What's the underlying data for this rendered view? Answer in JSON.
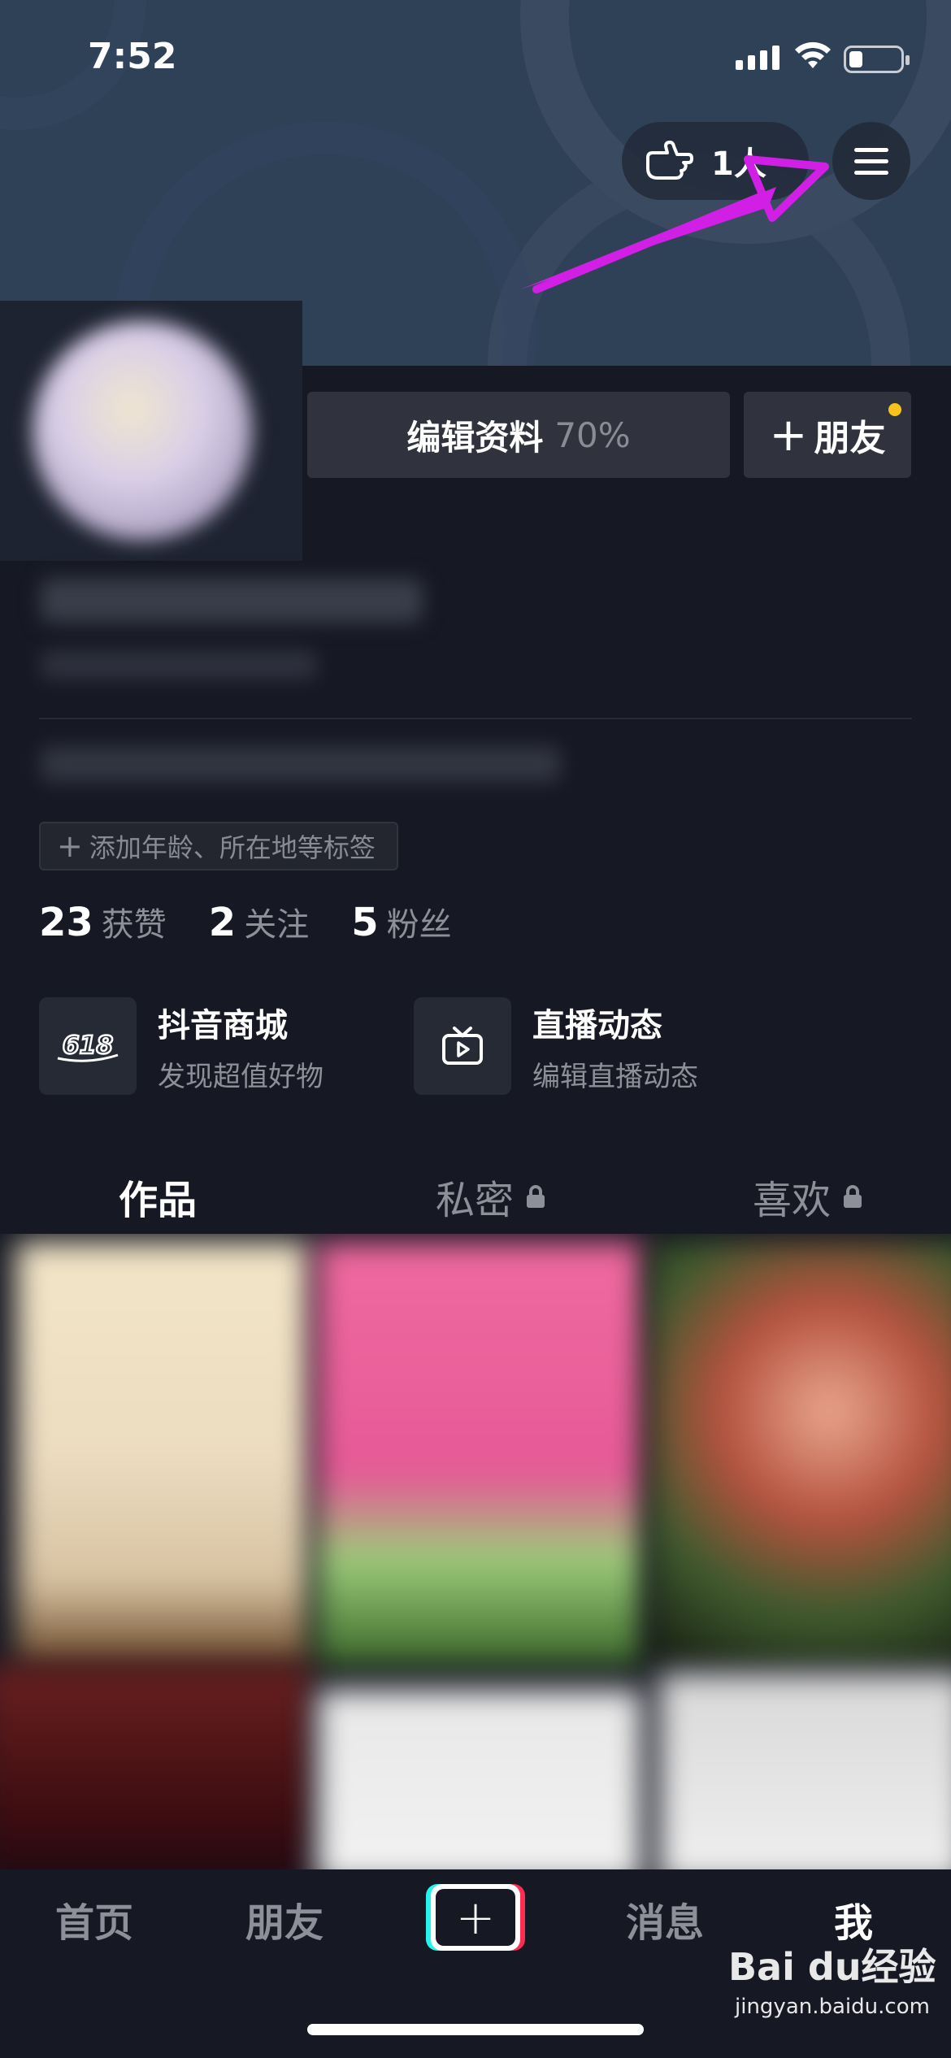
{
  "status_bar": {
    "time": "7:52"
  },
  "header": {
    "visitors_count": "1人"
  },
  "profile": {
    "edit_label": "编辑资料",
    "edit_percent": "70%",
    "add_friend_label": "朋友",
    "add_tag_label": "添加年龄、所在地等标签"
  },
  "stats": [
    {
      "num": "23",
      "label": "获赞"
    },
    {
      "num": "2",
      "label": "关注"
    },
    {
      "num": "5",
      "label": "粉丝"
    }
  ],
  "features": [
    {
      "title": "抖音商城",
      "subtitle": "发现超值好物",
      "icon": "618-icon",
      "icon_text": "618"
    },
    {
      "title": "直播动态",
      "subtitle": "编辑直播动态",
      "icon": "tv-icon"
    }
  ],
  "tabs": [
    {
      "label": "作品",
      "active": true
    },
    {
      "label": "私密",
      "locked": true
    },
    {
      "label": "喜欢",
      "locked": true
    }
  ],
  "bottom_nav": [
    {
      "label": "首页"
    },
    {
      "label": "朋友"
    },
    {
      "label": "消息"
    },
    {
      "label": "我",
      "active": true
    }
  ],
  "watermark": {
    "brand": "Bai du经验",
    "url": "jingyan.baidu.com"
  },
  "colors": {
    "background": "#161823",
    "banner": "#2e4157",
    "annotation_arrow": "#d21fe6",
    "notification_dot": "#f7c21c"
  }
}
